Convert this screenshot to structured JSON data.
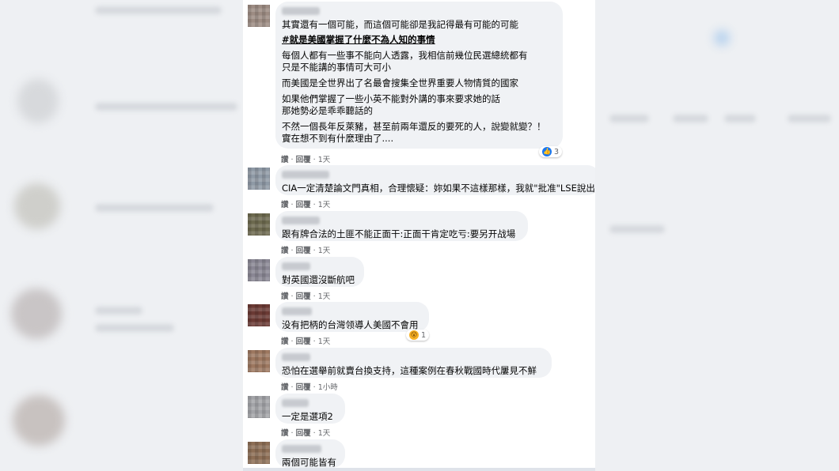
{
  "comments": [
    {
      "lines": [
        "其實還有一個可能，而這個可能卻是我記得最有可能的可能",
        "#就是美國掌握了什麼不為人知的事情",
        "每個人都有一些事不能向人透露，我相信前幾位民選總統都有",
        "只是不能講的事情可大可小",
        "而美國是全世界出了名最會搜集全世界重要人物情質的國家",
        "如果他們掌握了一些小英不能對外講的事來要求她的話",
        "那她勢必是乖乖聽話的",
        "不然一個長年反萊豬，甚至前兩年還反的要死的人，說變就變？！",
        "實在想不到有什麼理由了...."
      ],
      "like": "讚",
      "reply": "回覆",
      "time": "1天",
      "reaction_count": "3",
      "reaction_type": "like"
    },
    {
      "lines": [
        "CIA一定清楚論文門真相，合理懷疑：妳如果不這樣那樣，我就\"批准\"LSE說出"
      ],
      "like": "讚",
      "reply": "回覆",
      "time": "1天"
    },
    {
      "lines": [
        "跟有牌合法的土匪不能正面干:正面干肯定吃亏:要另开战場"
      ],
      "like": "讚",
      "reply": "回覆",
      "time": "1天"
    },
    {
      "lines": [
        "對英國還沒斷航吧"
      ],
      "like": "讚",
      "reply": "回覆",
      "time": "1天"
    },
    {
      "lines": [
        "没有把柄的台灣领導人美國不會用"
      ],
      "like": "讚",
      "reply": "回覆",
      "time": "1天",
      "reaction_count": "1",
      "reaction_type": "wow"
    },
    {
      "lines": [
        "恐怕在選舉前就賣台換支持，這種案例在春秋戰國時代屢見不鮮"
      ],
      "like": "讚",
      "reply": "回覆",
      "time": "1小時"
    },
    {
      "lines": [
        "一定是選項2"
      ],
      "like": "讚",
      "reply": "回覆",
      "time": "1天"
    },
    {
      "lines": [
        "兩個可能皆有"
      ]
    }
  ],
  "separator": "·",
  "icons": {
    "like_reaction": "thumbs-up-icon",
    "wow_reaction": "wow-face-icon"
  },
  "colors": {
    "bubble": "#f0f2f5",
    "meta": "#65676b",
    "like_blue": "#1877f2"
  }
}
